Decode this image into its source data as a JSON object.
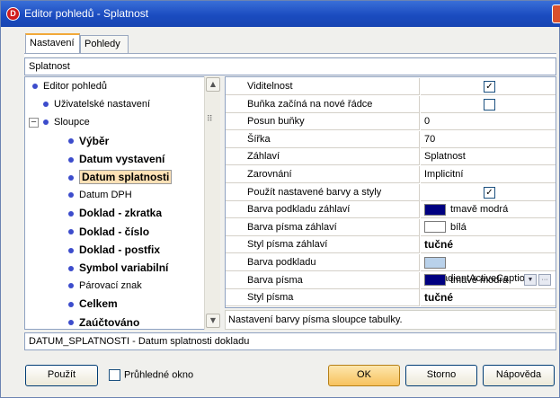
{
  "window": {
    "title": "Editor pohledů - Splatnost",
    "app_icon": "D"
  },
  "tabs": [
    {
      "label": "Nastavení",
      "active": true
    },
    {
      "label": "Pohledy",
      "active": false
    }
  ],
  "search": {
    "value": "Splatnost"
  },
  "tree": {
    "items": [
      {
        "label": "Editor pohledů",
        "level": 0,
        "bold": false
      },
      {
        "label": "Uživatelské nastavení",
        "level": 1,
        "bold": false
      },
      {
        "label": "Sloupce",
        "level": 0,
        "bold": false,
        "expanded": true
      },
      {
        "label": "Výběr",
        "level": 2,
        "bold": true
      },
      {
        "label": "Datum vystavení",
        "level": 2,
        "bold": true
      },
      {
        "label": "Datum splatnosti",
        "level": 2,
        "bold": true,
        "selected": true
      },
      {
        "label": "Datum DPH",
        "level": 2,
        "bold": false
      },
      {
        "label": "Doklad - zkratka",
        "level": 2,
        "bold": true
      },
      {
        "label": "Doklad - číslo",
        "level": 2,
        "bold": true
      },
      {
        "label": "Doklad - postfix",
        "level": 2,
        "bold": true
      },
      {
        "label": "Symbol variabilní",
        "level": 2,
        "bold": true
      },
      {
        "label": "Párovací znak",
        "level": 2,
        "bold": false
      },
      {
        "label": "Celkem",
        "level": 2,
        "bold": true
      },
      {
        "label": "Zaúčtováno",
        "level": 2,
        "bold": true
      }
    ]
  },
  "properties": [
    {
      "name": "Viditelnost",
      "type": "check",
      "checked": true
    },
    {
      "name": "Buňka začíná na nové řádce",
      "type": "check",
      "checked": false
    },
    {
      "name": "Posun buňky",
      "type": "text",
      "value": "0"
    },
    {
      "name": "Šířka",
      "type": "text",
      "value": "70"
    },
    {
      "name": "Záhlaví",
      "type": "text",
      "value": "Splatnost"
    },
    {
      "name": "Zarovnání",
      "type": "text",
      "value": "Implicitní"
    },
    {
      "name": "Použít nastavené barvy a styly",
      "type": "check",
      "checked": true
    },
    {
      "name": "Barva podkladu záhlaví",
      "type": "color",
      "value": "tmavě modrá",
      "color": "#000080"
    },
    {
      "name": "Barva písma záhlaví",
      "type": "color",
      "value": "bílá",
      "color": "#ffffff"
    },
    {
      "name": "Styl písma záhlaví",
      "type": "bold",
      "value": "tučné"
    },
    {
      "name": "Barva podkladu",
      "type": "color",
      "value": "clGradientActiveCaption",
      "color": "#b9d1ea"
    },
    {
      "name": "Barva písma",
      "type": "color-edit",
      "value": "tmavě modrá",
      "color": "#000080"
    },
    {
      "name": "Styl písma",
      "type": "bold",
      "value": "tučné"
    }
  ],
  "description": "Nastavení barvy písma sloupce tabulky.",
  "status": "DATUM_SPLATNOSTI - Datum splatnosti dokladu",
  "buttons": {
    "apply": "Použít",
    "transparent": "Průhledné okno",
    "ok": "OK",
    "cancel": "Storno",
    "help": "Nápověda"
  },
  "colors": {
    "title_bar": "#1b4cc0",
    "selection": "#fde1b6",
    "bullet": "#3c4ccc"
  }
}
